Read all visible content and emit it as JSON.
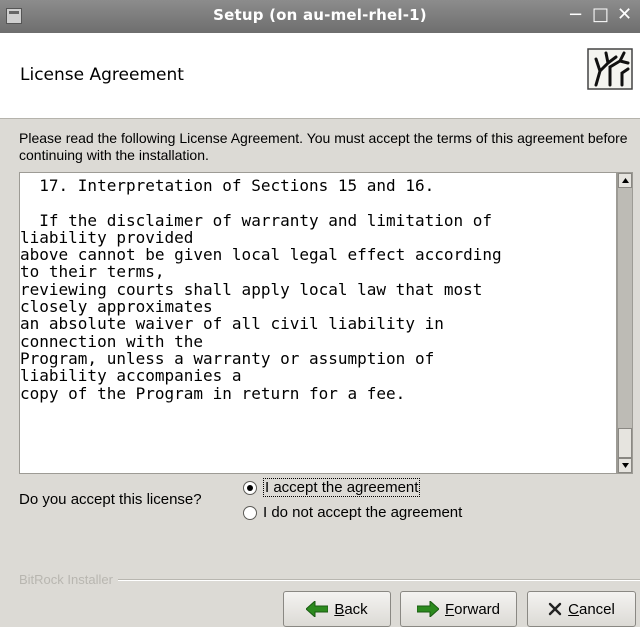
{
  "window": {
    "title": "Setup (on au-mel-rhel-1)",
    "controls": {
      "minimize": "−",
      "maximize": "□",
      "close": "✕"
    }
  },
  "header": {
    "title": "License Agreement"
  },
  "intro": "Please read the following License Agreement. You must accept the terms of this agreement before continuing with the installation.",
  "license_lines": [
    "  17. Interpretation of Sections 15 and 16.",
    "",
    "  If the disclaimer of warranty and limitation of",
    "liability provided",
    "above cannot be given local legal effect according",
    "to their terms,",
    "reviewing courts shall apply local law that most",
    "closely approximates",
    "an absolute waiver of all civil liability in",
    "connection with the",
    "Program, unless a warranty or assumption of",
    "liability accompanies a",
    "copy of the Program in return for a fee."
  ],
  "question": "Do you accept this license?",
  "options": [
    {
      "label": "I accept the agreement",
      "selected": true
    },
    {
      "label": "I do not accept the agreement",
      "selected": false
    }
  ],
  "footer": {
    "installer_label": "BitRock Installer",
    "buttons": {
      "back": {
        "mnemonic": "B",
        "rest": "ack"
      },
      "forward": {
        "mnemonic": "F",
        "rest": "orward"
      },
      "cancel": {
        "mnemonic": "C",
        "rest": "ancel"
      }
    }
  },
  "colors": {
    "titlebar": "#7d7d7d",
    "arrow": "#2c8a1e",
    "background": "#dcdad5"
  }
}
